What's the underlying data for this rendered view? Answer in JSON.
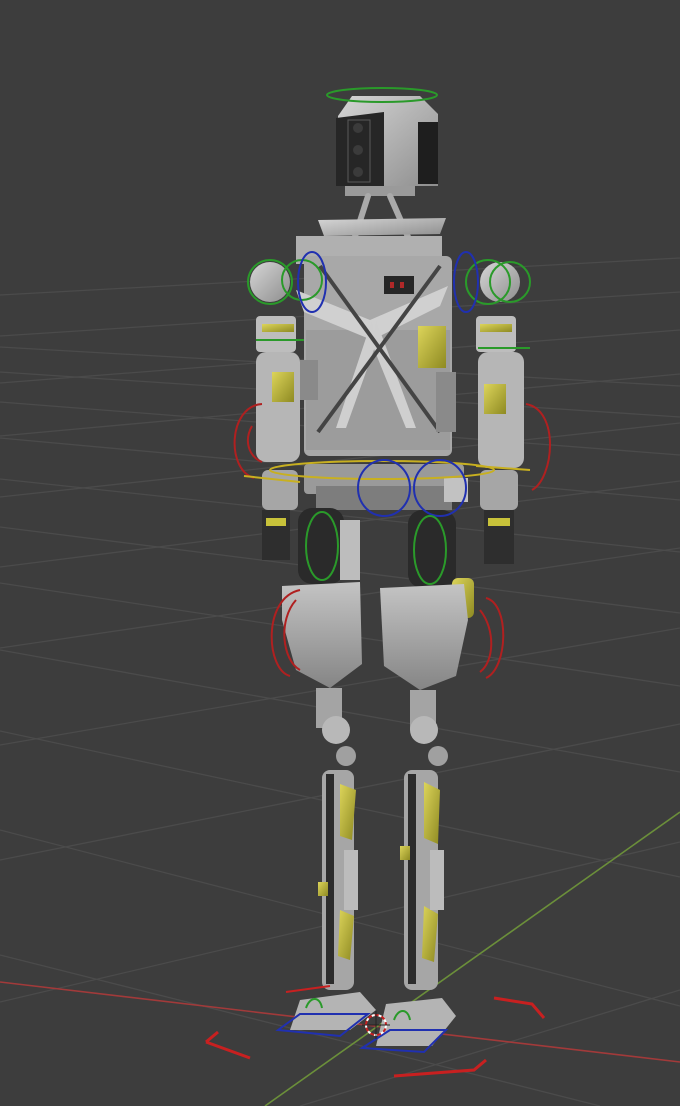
{
  "viewport": {
    "kind": "3D viewport",
    "background_color": "#3d3d3d",
    "grid_color": "#4b4b4b",
    "x_axis_color": "#a23a3a",
    "y_axis_color": "#6b8f3a"
  },
  "model": {
    "subject": "humanoid-robot-rig",
    "body_color": "#bdbdbd",
    "dark_part_color": "#2b2b2b",
    "accent_color": "#c8c23a"
  },
  "gizmo_colors": {
    "x_rotation": "#b02020",
    "y_rotation": "#2a9a2a",
    "z_rotation": "#2030b0",
    "root": "#c8b020",
    "foot_ik": "#c82020"
  },
  "icons": {
    "cursor": "3d-cursor-icon",
    "head": "head-rotation-control-icon"
  }
}
